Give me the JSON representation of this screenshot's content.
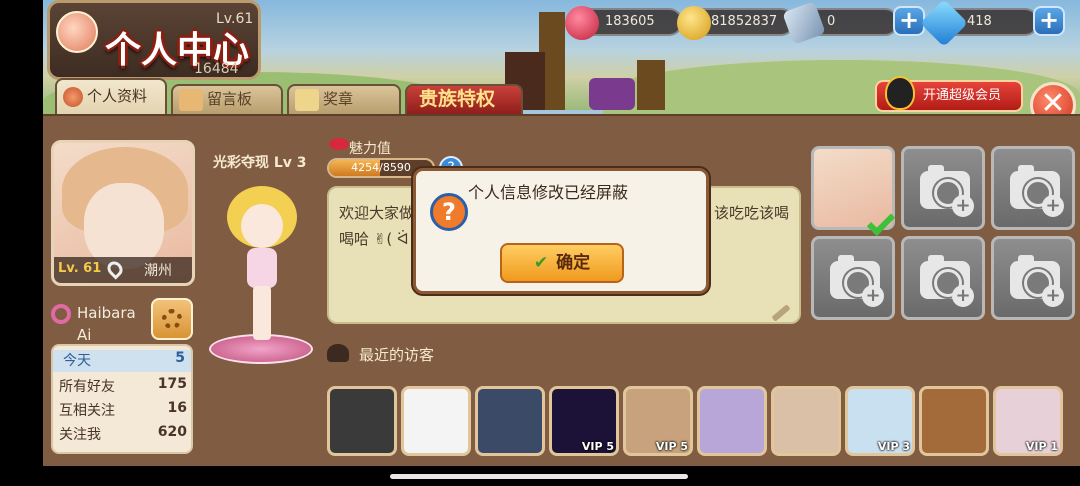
{
  "header": {
    "title": "个人中心",
    "level_top": "Lv.61",
    "id_number": "16484"
  },
  "resources": {
    "hearts": "183605",
    "coins": "81852837",
    "tickets": "0",
    "diamonds": "418"
  },
  "tabs": [
    {
      "label": "个人资料"
    },
    {
      "label": "留言板"
    },
    {
      "label": "奖章"
    },
    {
      "label": "贵族特权"
    }
  ],
  "vip_button": "开通超级会员",
  "profile": {
    "level": "Lv. 61",
    "location": "潮州",
    "name": "Haibara Ai",
    "rank": "光彩夺现 Lv 3",
    "charm_label": "魅力值",
    "charm_value": "4254/8590",
    "charm_ratio": 0.495,
    "bio": "欢迎大家做客，不急不躁，开心就好。不想，我爷为国。该吃吃该喝喝哈 ✌( ᐛ )"
  },
  "stats": [
    {
      "label": "今天",
      "value": "5"
    },
    {
      "label": "所有好友",
      "value": "175"
    },
    {
      "label": "互相关注",
      "value": "16"
    },
    {
      "label": "关注我",
      "value": "620"
    }
  ],
  "visitors_label": "最近的访客",
  "visitors": [
    {
      "vip": "",
      "color": "#3a3a3a"
    },
    {
      "vip": "",
      "color": "#f4f4f4"
    },
    {
      "vip": "",
      "color": "#3b4a66"
    },
    {
      "vip": "VIP 5",
      "color": "#1c1238"
    },
    {
      "vip": "VIP 5",
      "color": "#c7a27c"
    },
    {
      "vip": "",
      "color": "#b9a6d8"
    },
    {
      "vip": "",
      "color": "#d9c0a6"
    },
    {
      "vip": "VIP 3",
      "color": "#c9e0f0"
    },
    {
      "vip": "",
      "color": "#a36a3a"
    },
    {
      "vip": "VIP 1",
      "color": "#e8d0d8"
    }
  ],
  "modal": {
    "message": "个人信息修改已经屏蔽",
    "ok_label": "确定"
  }
}
